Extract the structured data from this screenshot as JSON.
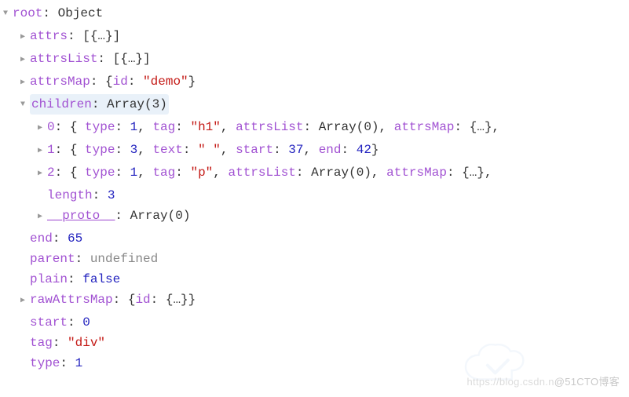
{
  "root": {
    "label": "root",
    "type": "Object",
    "attrs_key": "attrs",
    "attrs_val": "[{…}]",
    "attrsList_key": "attrsList",
    "attrsList_val": "[{…}]",
    "attrsMap_key": "attrsMap",
    "attrsMap_inner_key": "id",
    "attrsMap_inner_val": "\"demo\"",
    "children_key": "children",
    "children_val": "Array(3)",
    "children": {
      "i0": {
        "idx": "0",
        "pairs": [
          {
            "k": "type",
            "v": "1",
            "vt": "num"
          },
          {
            "k": "tag",
            "v": "\"h1\"",
            "vt": "str"
          },
          {
            "k": "attrsList",
            "v": "Array(0)",
            "vt": "val"
          },
          {
            "k": "attrsMap",
            "v": "{…},",
            "vt": "val"
          }
        ]
      },
      "i1": {
        "idx": "1",
        "pairs": [
          {
            "k": "type",
            "v": "3",
            "vt": "num"
          },
          {
            "k": "text",
            "v": "\" \"",
            "vt": "str"
          },
          {
            "k": "start",
            "v": "37",
            "vt": "num"
          },
          {
            "k": "end",
            "v": "42",
            "vt": "num"
          }
        ]
      },
      "i2": {
        "idx": "2",
        "pairs": [
          {
            "k": "type",
            "v": "1",
            "vt": "num"
          },
          {
            "k": "tag",
            "v": "\"p\"",
            "vt": "str"
          },
          {
            "k": "attrsList",
            "v": "Array(0)",
            "vt": "val"
          },
          {
            "k": "attrsMap",
            "v": "{…},",
            "vt": "val"
          }
        ]
      },
      "length_key": "length",
      "length_val": "3",
      "proto_key": "__proto__",
      "proto_val": "Array(0)"
    },
    "end_key": "end",
    "end_val": "65",
    "parent_key": "parent",
    "parent_val": "undefined",
    "plain_key": "plain",
    "plain_val": "false",
    "rawAttrsMap_key": "rawAttrsMap",
    "rawAttrsMap_inner_key": "id",
    "rawAttrsMap_inner_val": "{…}",
    "start_key": "start",
    "start_val": "0",
    "tag_key": "tag",
    "tag_val": "\"div\"",
    "type_key": "type",
    "type_val": "1"
  },
  "watermark": {
    "left": "https://blog.csdn.n",
    "right": "@51CTO博客"
  }
}
